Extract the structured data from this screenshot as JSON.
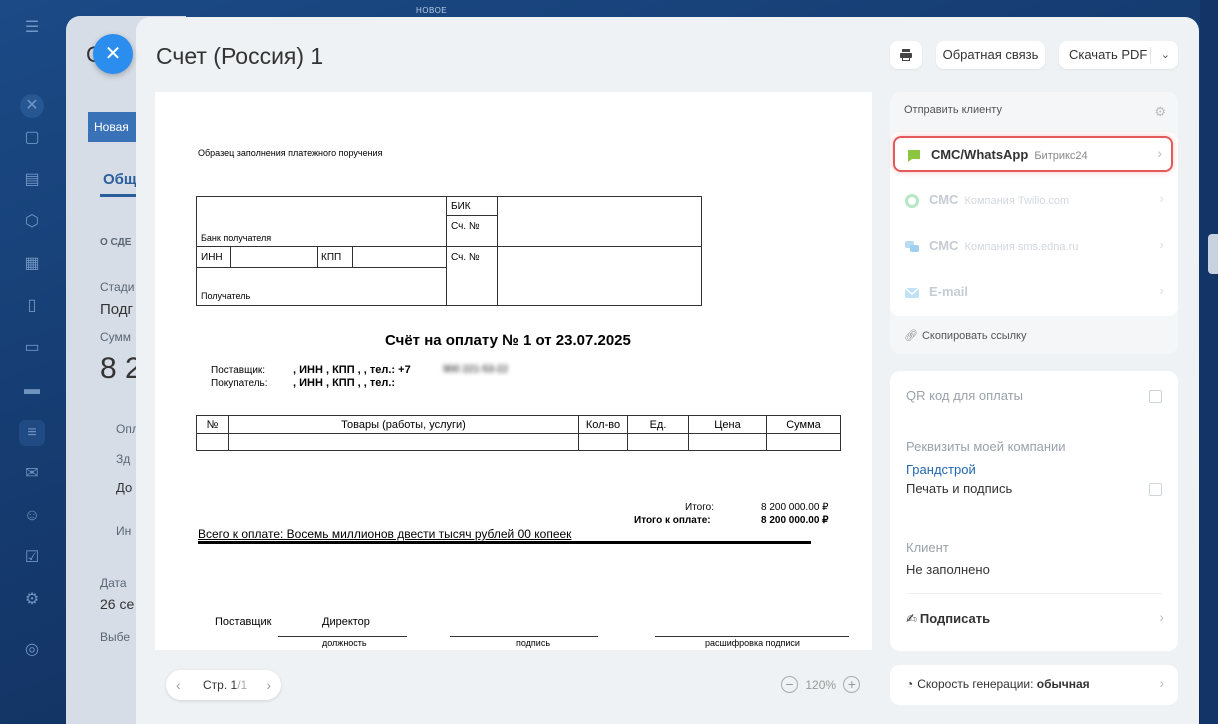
{
  "background": {
    "top_badge": "НОВОЕ",
    "stage_tab": "Новая",
    "fragments": [
      "С",
      "Общ",
      "О СДЕ",
      "Стади",
      "Подг",
      "Сумм",
      "8 2",
      "Опл",
      "Зд",
      "До",
      "Ин",
      "Дата",
      "26 се",
      "Выбе"
    ]
  },
  "close_label": "✕",
  "header": {
    "title": "Счет (Россия) 1",
    "feedback": "Обратная связь",
    "download_pdf": "Скачать PDF"
  },
  "document": {
    "sample_caption": "Образец заполнения платежного поручения",
    "bank": {
      "bik": "БИК",
      "acc1": "Сч. №",
      "acc2": "Сч. №",
      "recipient_bank": "Банк получателя",
      "inn": "ИНН",
      "kpp": "КПП",
      "recipient": "Получатель"
    },
    "invoice_title": "Счёт на оплату № 1 от 23.07.2025",
    "supplier_label": "Поставщик:",
    "supplier_value": ", ИНН , КПП , , тел.: +7",
    "supplier_phone": "900 221-53-22",
    "buyer_label": "Покупатель:",
    "buyer_value": ", ИНН , КПП , , тел.:",
    "table_headers": [
      "№",
      "Товары (работы, услуги)",
      "Кол-во",
      "Ед.",
      "Цена",
      "Сумма"
    ],
    "total_label": "Итого:",
    "total_value": "8 200 000.00 ₽",
    "total_pay_label": "Итого к оплате:",
    "total_pay_value": "8 200 000.00 ₽",
    "amount_words": "Всего к оплате: Восемь миллионов двести тысяч рублей 00 копеек",
    "sign_supplier": "Поставщик",
    "sign_position": "Директор",
    "sign_caption_position": "должность",
    "sign_caption_signature": "подпись",
    "sign_caption_decoding": "расшифровка подписи"
  },
  "pager": {
    "label": "Стр. 1",
    "total": "/1"
  },
  "zoom": {
    "value": "120%"
  },
  "send": {
    "heading": "Отправить клиенту",
    "items": [
      {
        "name": "СМС/WhatsApp",
        "sub": "Битрикс24",
        "color": "#8cc63f"
      },
      {
        "name": "СМС",
        "sub": "Компания Twilio.com",
        "color": "#b8e6c4"
      },
      {
        "name": "СМС",
        "sub": "Компания sms.edna.ru",
        "color": "#b9dcf3"
      },
      {
        "name": "E-mail",
        "sub": "",
        "color": "#bfe3f4"
      }
    ],
    "copy_link": "Скопировать ссылку"
  },
  "options": {
    "qr": "QR код для оплаты",
    "company_label": "Реквизиты моей компании",
    "company_name": "Грандстрой",
    "print_sign": "Печать и подпись",
    "client_label": "Клиент",
    "client_value": "Не заполнено",
    "sign_action": "Подписать"
  },
  "speed": {
    "label": "Скорость генерации:",
    "value": "обычная"
  }
}
